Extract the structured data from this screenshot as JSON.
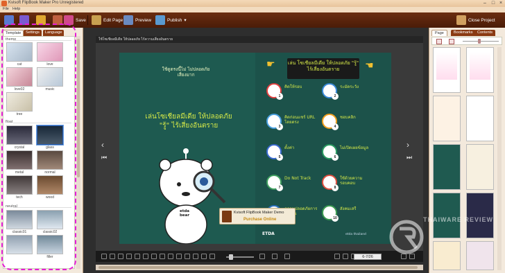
{
  "window": {
    "title": "Kvisoft FlipBook Maker Pro Unregistered"
  },
  "menu": [
    "File",
    "Help"
  ],
  "toolbar": {
    "save": "Save",
    "edit_page": "Edit Page",
    "preview": "Preview",
    "publish": "Publish",
    "close_project": "Close Project"
  },
  "left_panel": {
    "tabs": [
      "Template",
      "Settings",
      "Language"
    ],
    "groups": [
      {
        "name": "theme",
        "items": [
          "cat",
          "love",
          "love02",
          "music",
          "tree"
        ]
      },
      {
        "name": "float",
        "items": [
          "crystal",
          "glass",
          "metal",
          "normal",
          "tech",
          "wood"
        ]
      },
      {
        "name": "neutral",
        "items": [
          "classic01",
          "classic02",
          "",
          "filler"
        ]
      }
    ]
  },
  "center": {
    "doc_title": "ใช้โซเชียลมีเดีย ให้ปลอดภัย ไร้ความเสี่ยงอันตราย",
    "left_page": {
      "handwritten": "ใช้ดูตรงนี้ไม่ ไม่ปลอดภัย เสี่ยงมาก",
      "headline": "เล่นโซเชียลมีเดีย ให้ปลอดภัย \"รู้\" ไร้เสี่ยงอันตราย",
      "mascot_badge": "etda bear"
    },
    "right_page": {
      "banner": "เล่น โซเชียลมีเดีย ให้ปลอดภัย \"รู้\" ไร้เสี่ยงอันตราย",
      "tips": [
        {
          "num": "1",
          "title": "คิดให้รอบ"
        },
        {
          "num": "2",
          "title": "ระมัดระวัง"
        },
        {
          "num": "3",
          "title": "คิดก่อนแชร์ URL โดยตรง"
        },
        {
          "num": "4",
          "title": "ชอบคลิก"
        },
        {
          "num": "5",
          "title": "ตั้งค่า"
        },
        {
          "num": "6",
          "title": "ไม่เปิดเผยข้อมูล"
        },
        {
          "num": "7",
          "title": "Do Not Track"
        },
        {
          "num": "8",
          "title": "ใช้ด้วยความรอบคอบ"
        },
        {
          "num": "9",
          "title": "ความปลอดภัยการใช้งาน"
        },
        {
          "num": "10",
          "title": "สังคมเสรี"
        }
      ],
      "footer_brand": "ETDA",
      "footer_social": "etda thailand"
    },
    "demo_banner": {
      "line1": "Kvisoft FlipBook Maker Demo",
      "line2": "Purchase Online"
    },
    "page_indicator": "6-7/26"
  },
  "right_panel": {
    "tabs": [
      "Page",
      "Bookmarks",
      "Contents"
    ]
  },
  "watermark": "THAIWARE REVIEW",
  "colors": {
    "toolbar_bg": "#4a1c08",
    "page_green": "#1e5a50",
    "highlight_dashed": "#e51ed6",
    "accent_yellow": "#c58a10"
  }
}
